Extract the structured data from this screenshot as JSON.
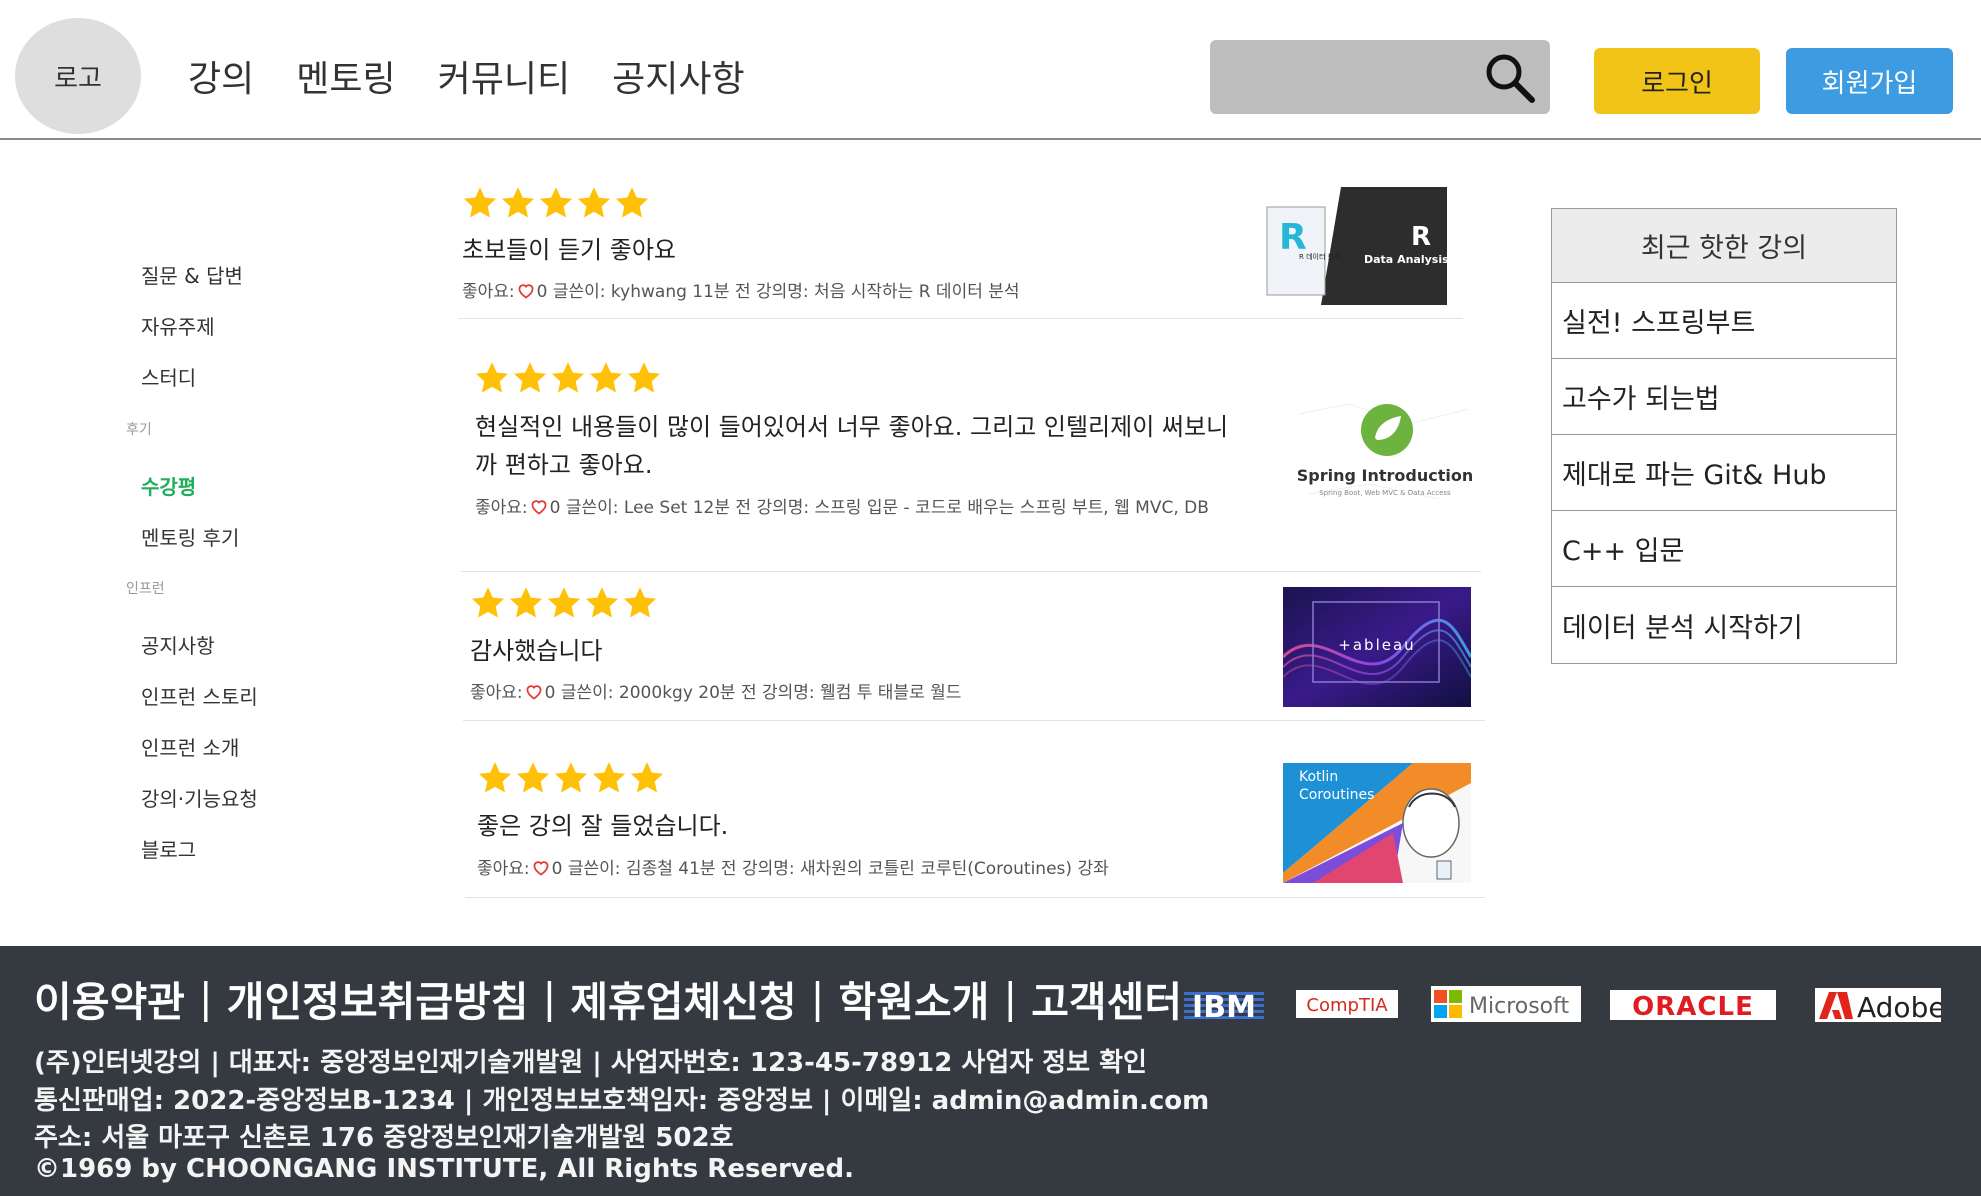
{
  "header": {
    "logo_label": "로고",
    "nav": [
      "강의",
      "멘토링",
      "커뮤니티",
      "공지사항"
    ],
    "search_placeholder": "",
    "login_label": "로그인",
    "join_label": "회원가입"
  },
  "sidebar": {
    "group1": [
      "질문 & 답변",
      "자유주제",
      "스터디"
    ],
    "section_review": "후기",
    "group2": [
      "수강평",
      "멘토링 후기"
    ],
    "active_item": "수강평",
    "section_inflearn": "인프런",
    "group3": [
      "공지사항",
      "인프런 스토리",
      "인프런 소개",
      "강의·기능요청",
      "블로그"
    ]
  },
  "reviews": [
    {
      "rating": 5,
      "title": "초보들이 듣기 좋아요",
      "meta_prefix": "좋아요:",
      "meta_text": "0 글쓴이: kyhwang 11분 전 강의명: 처음 시작하는 R 데이터 분석",
      "thumb": {
        "title": "R",
        "subtitle": "Data Analysis",
        "book_label": "R 데이터 분석"
      }
    },
    {
      "rating": 5,
      "title_line1": "현실적인 내용들이 많이 들어있어서 너무 좋아요. 그리고 인텔리제이 써보니",
      "title_line2": "까 편하고 좋아요.",
      "meta_prefix": "좋아요:",
      "meta_text": "0 글쓴이: Lee Set 12분 전 강의명: 스프링 입문 - 코드로 배우는 스프링 부트, 웹 MVC, DB",
      "thumb": {
        "title": "Spring Introduction",
        "subtitle": "Spring Boot, Web MVC & Data Access"
      }
    },
    {
      "rating": 5,
      "title": "감사했습니다",
      "meta_prefix": "좋아요:",
      "meta_text": "0 글쓴이: 2000kgy 20분 전 강의명: 웰컴 투 태블로 월드",
      "thumb": {
        "title": "+ableau"
      }
    },
    {
      "rating": 5,
      "title": "좋은 강의 잘 들었습니다.",
      "meta_prefix": "좋아요:",
      "meta_text": "0 글쓴이: 김종철 41분 전 강의명: 새차원의 코틀린 코루틴(Coroutines) 강좌",
      "thumb": {
        "line1": "Kotlin",
        "line2": "Coroutines"
      }
    }
  ],
  "recent": {
    "title": "최근 핫한 강의",
    "items": [
      "실전! 스프링부트",
      "고수가 되는법",
      "제대로 파는 Git& Hub",
      "C++ 입문",
      "데이터 분석 시작하기"
    ]
  },
  "footer": {
    "links": [
      "이용약관",
      "개인정보취급방침",
      "제휴업체신청",
      "학원소개",
      "고객센터"
    ],
    "separator": "|",
    "partners": [
      "IBM",
      "CompTIA",
      "Microsoft",
      "ORACLE",
      "Adobe"
    ],
    "info": [
      "(주)인터넷강의 | 대표자: 중앙정보인재기술개발원 | 사업자번호: 123-45-78912 사업자 정보 확인",
      "통신판매업: 2022-중앙정보B-1234 | 개인정보보호책임자: 중앙정보 | 이메일: admin@admin.com",
      "주소: 서울 마포구 신촌로 176 중앙정보인재기술개발원 502호",
      "©1969 by CHOONGANG INSTITUTE, All Rights Reserved."
    ]
  },
  "colors": {
    "login_button": "#f2c418",
    "join_button": "#3d9be2",
    "active_menu": "#1fae5b",
    "star": "#ffc107",
    "footer_bg": "#343a40"
  }
}
